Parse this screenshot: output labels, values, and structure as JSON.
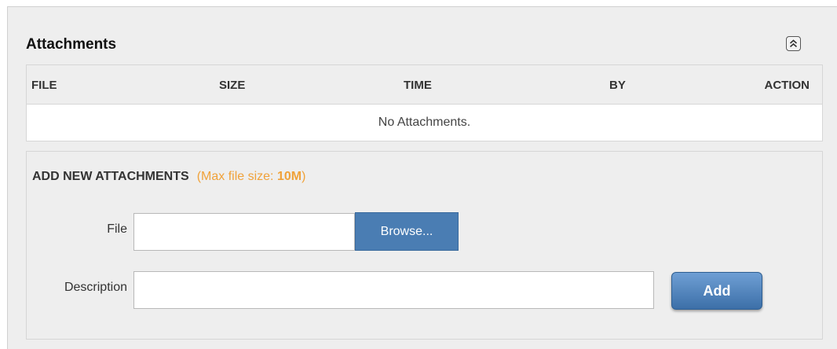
{
  "panel": {
    "title": "Attachments",
    "collapse_icon": "double-chevron-up-icon"
  },
  "table": {
    "columns": [
      "FILE",
      "SIZE",
      "TIME",
      "BY",
      "ACTION"
    ],
    "empty_text": "No Attachments."
  },
  "add_section": {
    "title": "ADD NEW ATTACHMENTS",
    "hint_prefix": "(Max file size: ",
    "max_size": "10M",
    "hint_suffix": ")",
    "file_label": "File",
    "file_value": "",
    "browse_label": "Browse...",
    "description_label": "Description",
    "description_value": "",
    "add_label": "Add"
  },
  "colors": {
    "hint": "#f0a23a",
    "browse_button": "#4a7db3",
    "add_button": "#3c6fa8"
  }
}
